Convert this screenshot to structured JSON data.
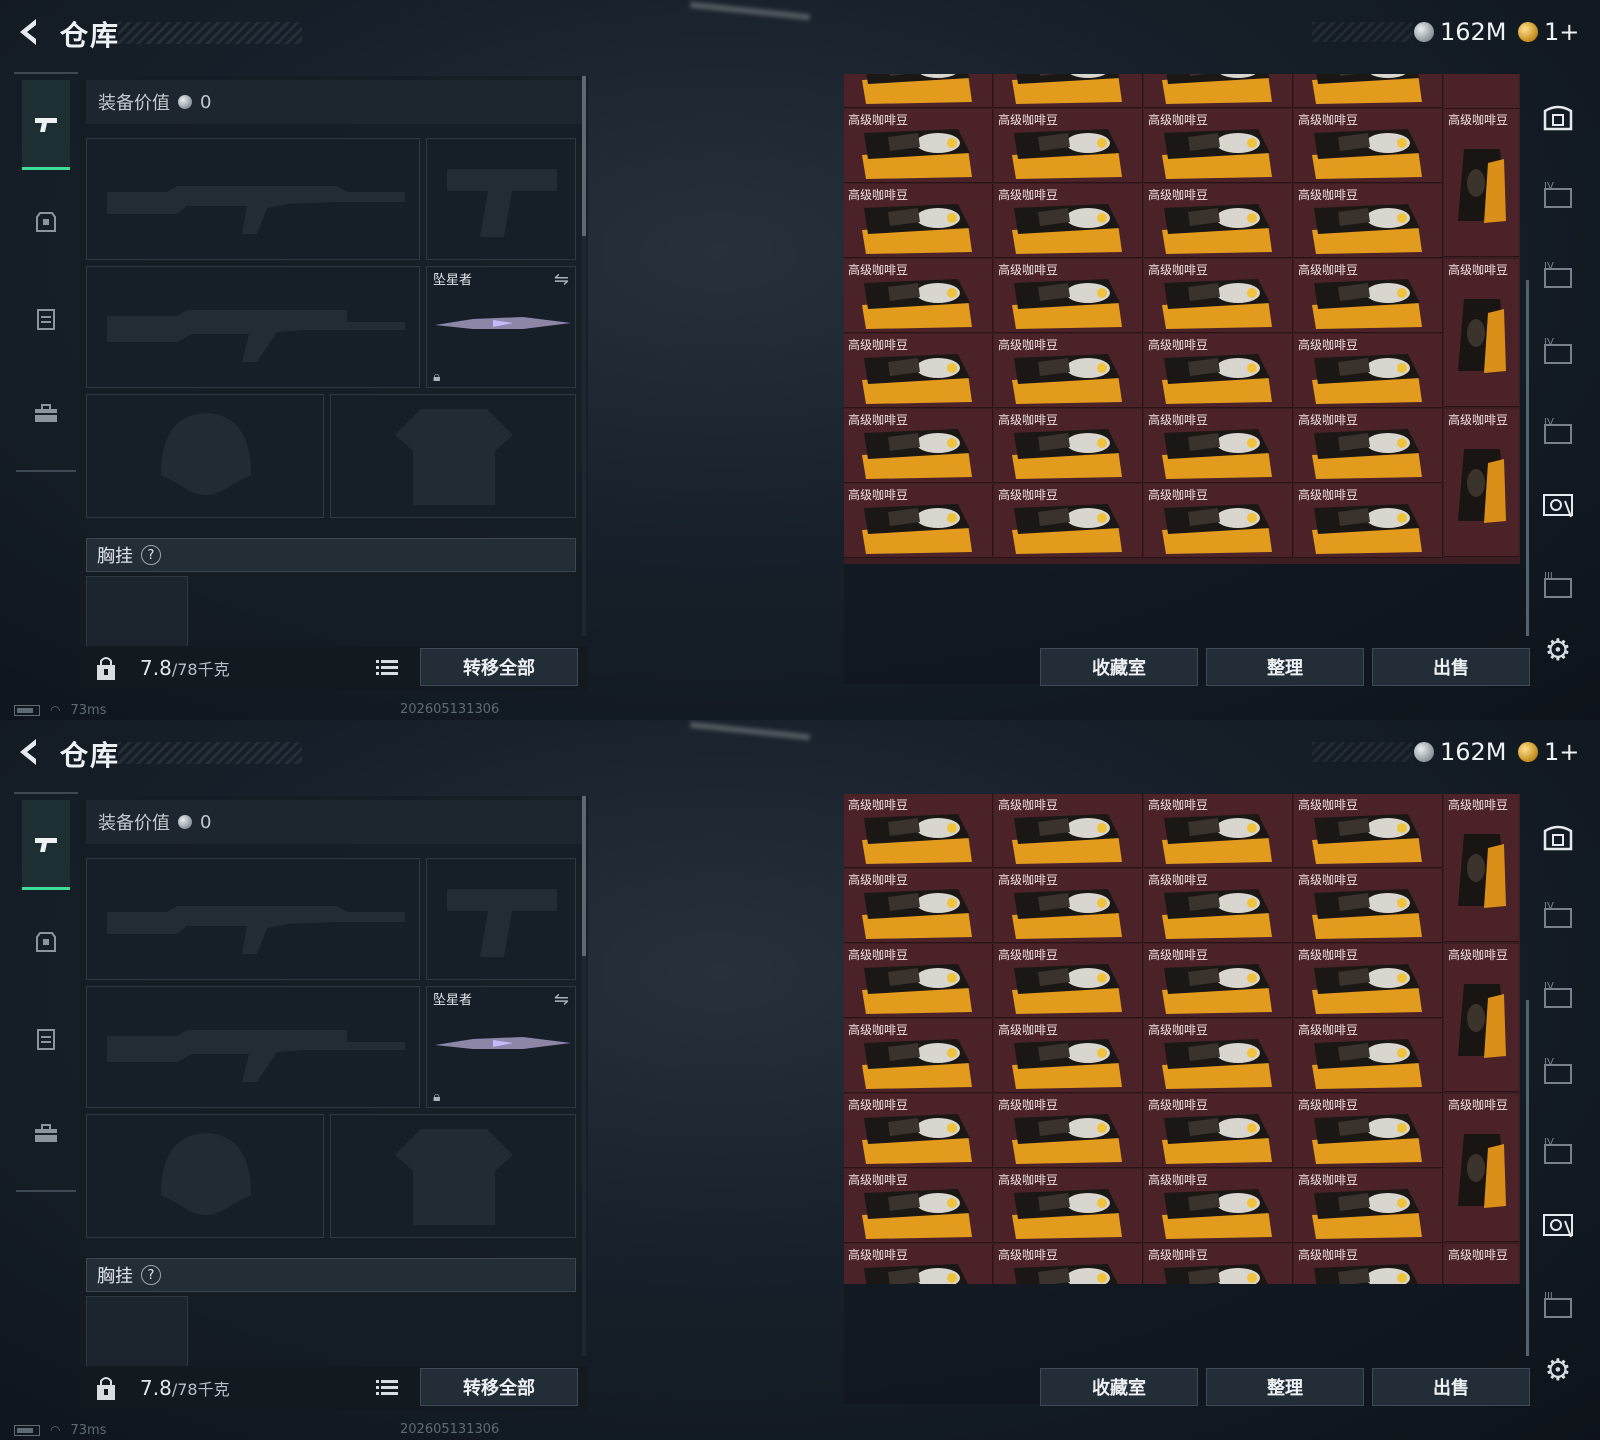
{
  "screens": [
    {
      "title": "仓库",
      "currency": {
        "silver": "162M",
        "gold": "1+"
      },
      "equipment": {
        "value_label": "装备价值",
        "value": "0",
        "melee_name": "坠星者",
        "chest_rig_label": "胸挂",
        "help_label": "?",
        "weight_current": "7.8",
        "weight_max": "/78千克",
        "transfer_label": "转移全部"
      },
      "inventory": {
        "item_label": "高级咖啡豆",
        "rows": 6,
        "first_row_partial": true
      },
      "actions": {
        "collection": "收藏室",
        "sort": "整理",
        "sell": "出售"
      },
      "status": {
        "ping": "73ms",
        "build": "202605131306"
      }
    },
    {
      "title": "仓库",
      "currency": {
        "silver": "162M",
        "gold": "1+"
      },
      "equipment": {
        "value_label": "装备价值",
        "value": "0",
        "melee_name": "坠星者",
        "chest_rig_label": "胸挂",
        "help_label": "?",
        "weight_current": "7.8",
        "weight_max": "/78千克",
        "transfer_label": "转移全部"
      },
      "inventory": {
        "item_label": "高级咖啡豆",
        "rows": 7,
        "first_row_partial": false
      },
      "actions": {
        "collection": "收藏室",
        "sort": "整理",
        "sell": "出售"
      },
      "status": {
        "ping": "73ms",
        "build": "202605131306"
      }
    }
  ],
  "colors": {
    "accent": "#3ddc97",
    "item_bg": "#4a2228",
    "panel": "#161f28"
  },
  "icons": {
    "back": "back-arrow-icon",
    "nav": [
      "pistol-icon",
      "backpack-icon",
      "vest-icon",
      "toolbox-icon"
    ],
    "rail": [
      "safe-icon",
      "tier-iv-case-icon",
      "tier-iv-case-icon",
      "tier-iv-case-icon",
      "tier-iv-case-icon",
      "photo-case-icon",
      "tier-iii-case-icon"
    ],
    "settings": "gear-icon"
  }
}
